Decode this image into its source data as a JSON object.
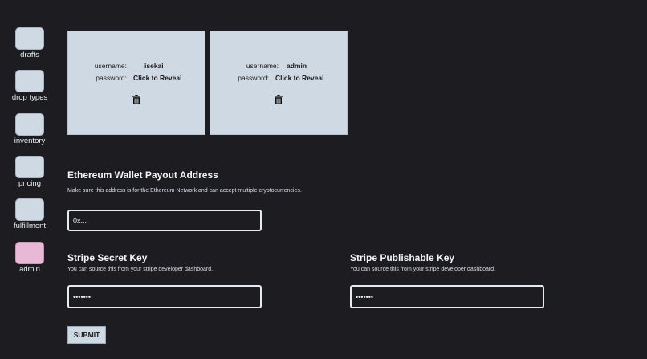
{
  "sidebar": {
    "items": [
      {
        "label": "drafts",
        "color": "#cfd9e4"
      },
      {
        "label": "drop types",
        "color": "#cfd9e4"
      },
      {
        "label": "inventory",
        "color": "#cfd9e4"
      },
      {
        "label": "pricing",
        "color": "#cfd9e4"
      },
      {
        "label": "fulfillment",
        "color": "#cfd9e4"
      },
      {
        "label": "admin",
        "color": "#e7b9d6"
      }
    ]
  },
  "accounts": [
    {
      "username_label": "username:",
      "username": "isekai",
      "password_label": "password:",
      "password": "Click to Reveal",
      "delete_icon": "trash-icon"
    },
    {
      "username_label": "username:",
      "username": "admin",
      "password_label": "password:",
      "password": "Click to Reveal",
      "delete_icon": "trash-icon"
    }
  ],
  "wallet": {
    "title": "Ethereum Wallet Payout Address",
    "help": "Make sure this address is for the Ethereum Network and can accept multiple cryptocurrencies.",
    "placeholder": "0x..."
  },
  "stripe_secret": {
    "title": "Stripe Secret Key",
    "help": "You can source this from your stripe developer dashboard.",
    "value": "•••••••"
  },
  "stripe_publishable": {
    "title": "Stripe Publishable Key",
    "help": "You can source this from your stripe developer dashboard.",
    "value": "•••••••"
  },
  "submit_label": "SUBMIT",
  "colors": {
    "background": "#1c1c21",
    "tile": "#cfd9e4",
    "active_tile": "#e7b9d6"
  }
}
